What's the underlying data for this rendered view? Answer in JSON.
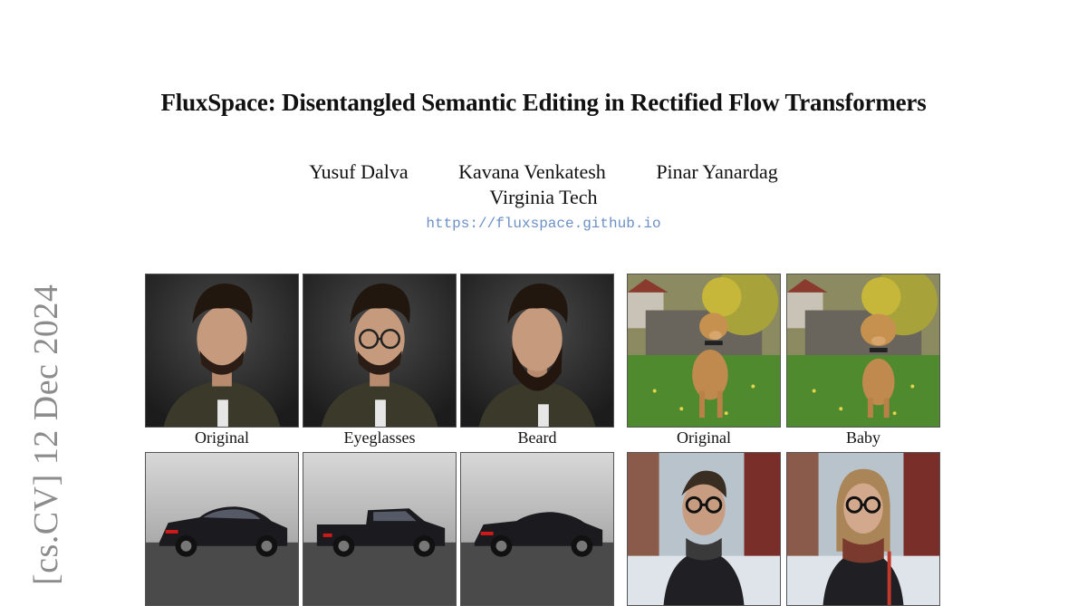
{
  "paper": {
    "title": "FluxSpace: Disentangled Semantic Editing in Rectified Flow Transformers",
    "authors": [
      "Yusuf Dalva",
      "Kavana Venkatesh",
      "Pinar Yanardag"
    ],
    "affiliation": "Virginia Tech",
    "url": "https://fluxspace.github.io",
    "arxiv_stamp": "[cs.CV]  12 Dec 2024"
  },
  "figure": {
    "row1_captions": [
      "Original",
      "Eyeglasses",
      "Beard",
      "Original",
      "Baby"
    ]
  }
}
